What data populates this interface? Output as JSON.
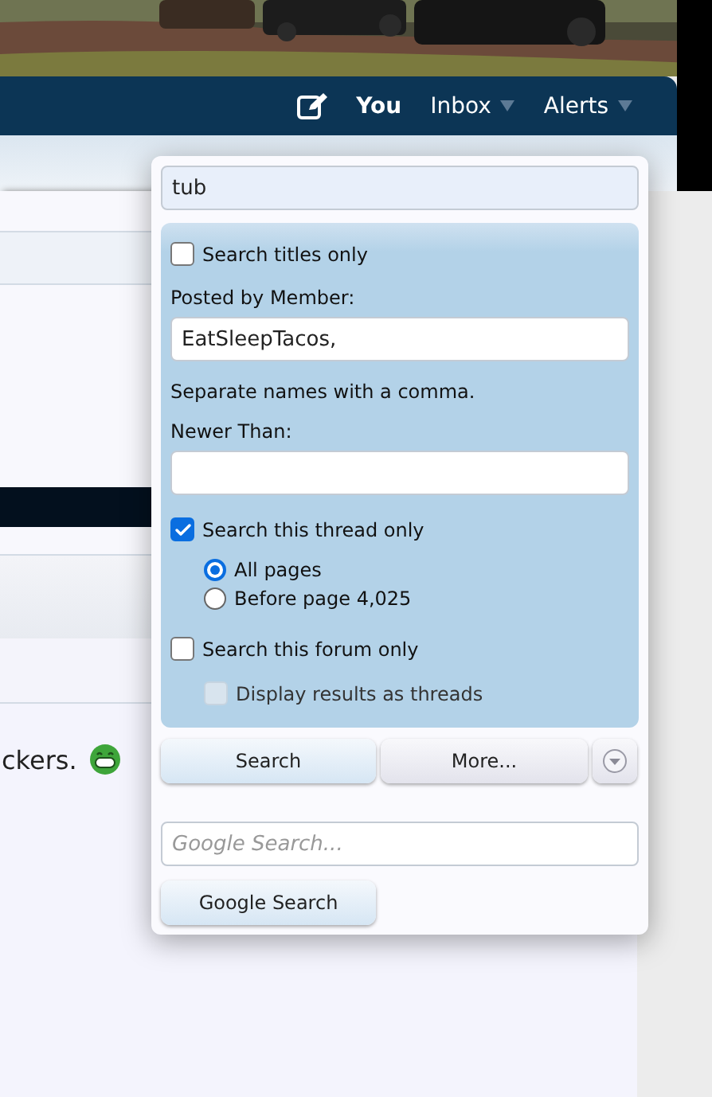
{
  "nav": {
    "items": [
      {
        "label": "You",
        "bold": true,
        "menu": false
      },
      {
        "label": "Inbox",
        "bold": false,
        "menu": true
      },
      {
        "label": "Alerts",
        "bold": false,
        "menu": true
      }
    ]
  },
  "post": {
    "text": "ckers."
  },
  "search_popup": {
    "query": "tub",
    "titles_only": {
      "label": "Search titles only",
      "checked": false
    },
    "member": {
      "label": "Posted by Member:",
      "value": "EatSleepTacos,",
      "note": "Separate names with a comma."
    },
    "newer": {
      "label": "Newer Than:"
    },
    "thread_only": {
      "label": "Search this thread only",
      "checked": true,
      "pages": [
        {
          "label": "All pages",
          "selected": true
        },
        {
          "label": "Before page 4,025",
          "selected": false
        }
      ]
    },
    "forum_only": {
      "label": "Search this forum only",
      "checked": false
    },
    "display_threads": {
      "label": "Display results as threads",
      "checked": false,
      "disabled": true
    },
    "buttons": [
      {
        "label": "Search"
      },
      {
        "label": "More..."
      }
    ],
    "google": {
      "placeholder": "Google Search...",
      "button": "Google Search"
    }
  }
}
